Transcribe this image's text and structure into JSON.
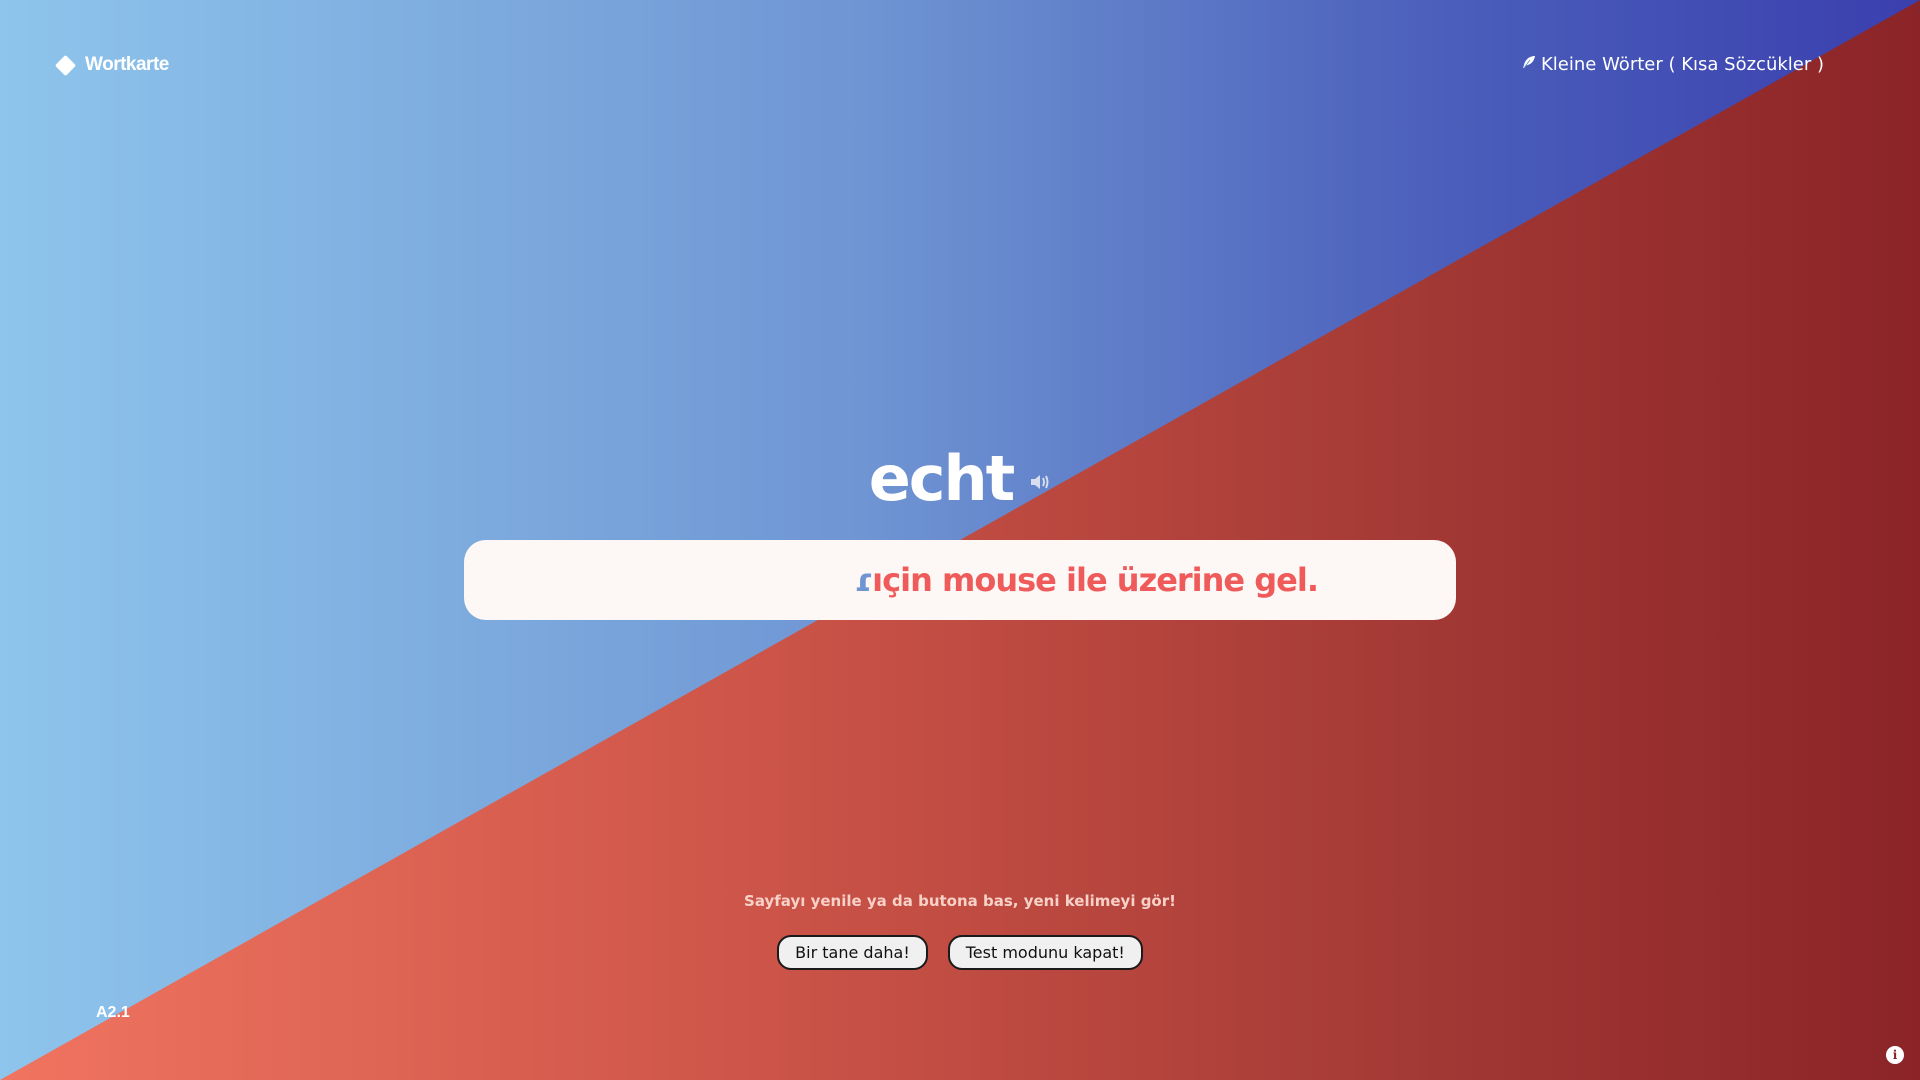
{
  "brand": {
    "name": "Wortkarte",
    "icon": "diamond-icon"
  },
  "header": {
    "category_icon": "feather-icon",
    "category_label": "Kleine Wörter ( Kısa Sözcükler )"
  },
  "card": {
    "word": "echt",
    "speaker_icon": "speaker-icon",
    "answer_hint_cut": "ɾ",
    "answer_hint": "ıçin mouse ile üzerine gel."
  },
  "footer": {
    "refresh_hint": "Sayfayı yenile ya da butona bas, yeni kelimeyi gör!",
    "next_button": "Bir tane daha!",
    "test_mode_button": "Test modunu kapat!",
    "level": "A2.1",
    "info_icon": "info-icon"
  },
  "colors": {
    "blue_start": "#8ec5ec",
    "blue_end": "#3a3fae",
    "red_start": "#f07460",
    "red_end": "#8b2428",
    "answer_text": "#ef5a5a"
  }
}
